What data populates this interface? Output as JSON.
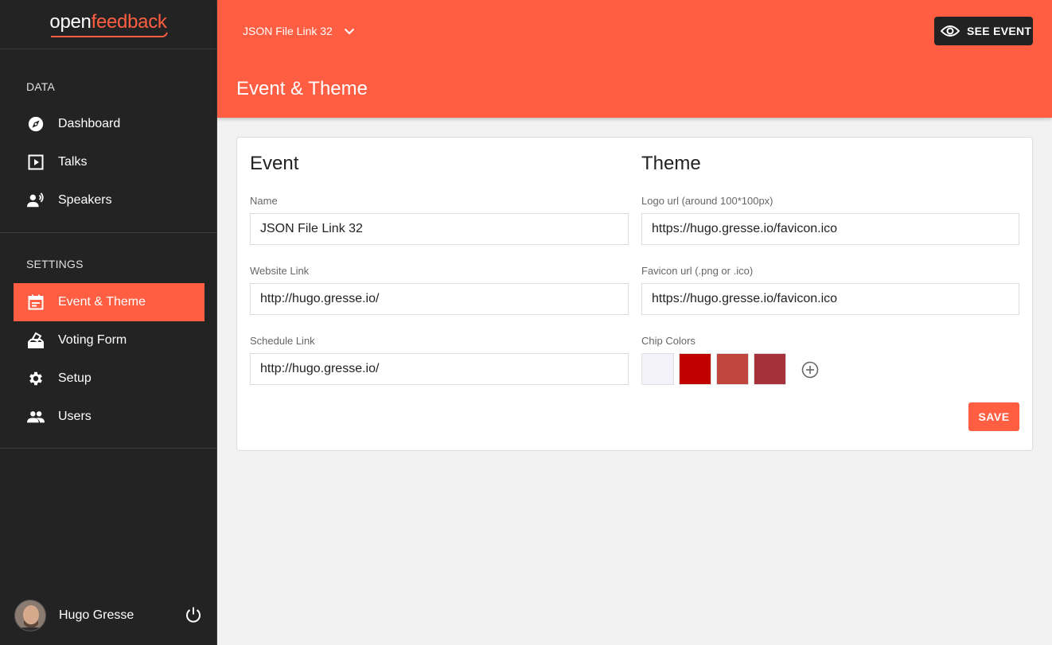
{
  "brand": {
    "open": "open",
    "feedback": "feedback",
    "accent": "#ff5e42"
  },
  "sidebar": {
    "data_label": "DATA",
    "data_items": [
      {
        "label": "Dashboard",
        "icon": "compass-icon"
      },
      {
        "label": "Talks",
        "icon": "play-box-icon"
      },
      {
        "label": "Speakers",
        "icon": "speaker-person-icon"
      }
    ],
    "settings_label": "SETTINGS",
    "settings_items": [
      {
        "label": "Event & Theme",
        "icon": "calendar-icon",
        "active": true
      },
      {
        "label": "Voting Form",
        "icon": "ballot-box-icon"
      },
      {
        "label": "Setup",
        "icon": "gear-icon"
      },
      {
        "label": "Users",
        "icon": "people-icon"
      }
    ],
    "user": {
      "name": "Hugo Gresse"
    }
  },
  "header": {
    "event_name": "JSON File Link 32",
    "see_event_label": "SEE EVENT",
    "page_title": "Event & Theme"
  },
  "event_section": {
    "title": "Event",
    "name_label": "Name",
    "name_value": "JSON File Link 32",
    "website_label": "Website Link",
    "website_value": "http://hugo.gresse.io/",
    "schedule_label": "Schedule Link",
    "schedule_value": "http://hugo.gresse.io/"
  },
  "theme_section": {
    "title": "Theme",
    "logo_label": "Logo url (around 100*100px)",
    "logo_value": "https://hugo.gresse.io/favicon.ico",
    "favicon_label": "Favicon url (.png or .ico)",
    "favicon_value": "https://hugo.gresse.io/favicon.ico",
    "chip_colors_label": "Chip Colors",
    "chip_colors": [
      "#f3f2fb",
      "#c10000",
      "#c1453f",
      "#a5313a"
    ]
  },
  "save_label": "SAVE"
}
